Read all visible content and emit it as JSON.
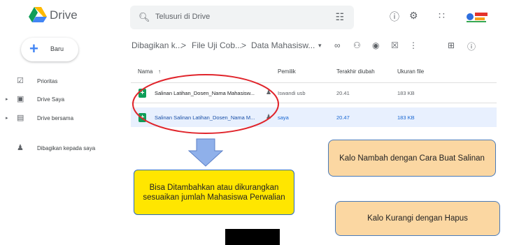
{
  "header": {
    "app_title": "Drive",
    "search_placeholder": "Telusuri di Drive"
  },
  "sidebar": {
    "new_label": "Baru",
    "items": [
      {
        "label": "Prioritas",
        "icon": "check-circle-icon"
      },
      {
        "label": "Drive Saya",
        "icon": "my-drive-icon"
      },
      {
        "label": "Drive bersama",
        "icon": "shared-drives-icon"
      },
      {
        "label": "Dibagikan kepada saya",
        "icon": "people-icon"
      }
    ]
  },
  "breadcrumb": {
    "items": [
      "Dibagikan k...",
      "File Uji Cob...",
      "Data Mahasisw..."
    ],
    "separator": ">"
  },
  "table": {
    "columns": {
      "name": "Nama",
      "owner": "Pemilik",
      "modified": "Terakhir diubah",
      "size": "Ukuran file"
    },
    "rows": [
      {
        "name": "Salinan Latihan_Dosen_Nama Mahasisw...",
        "owner": "Iswandi usb",
        "modified": "20.41",
        "size": "183 KB",
        "selected": false
      },
      {
        "name": "Salinan Salinan Latihan_Dosen_Nama M...",
        "owner": "saya",
        "modified": "20.47",
        "size": "183 KB",
        "selected": true
      }
    ]
  },
  "annotations": {
    "yellow_note": "Bisa Ditambahkan atau dikurangkan sesuaikan jumlah Mahasiswa Perwalian",
    "add_note": "Kalo Nambah dengan Cara Buat Salinan",
    "remove_note": "Kalo Kurangi dengan Hapus"
  },
  "colors": {
    "highlight_circle": "#e0242b",
    "arrow_fill": "#8fb0ea",
    "selected_row": "#e8f0fe",
    "sheets_green": "#0f9d58"
  }
}
